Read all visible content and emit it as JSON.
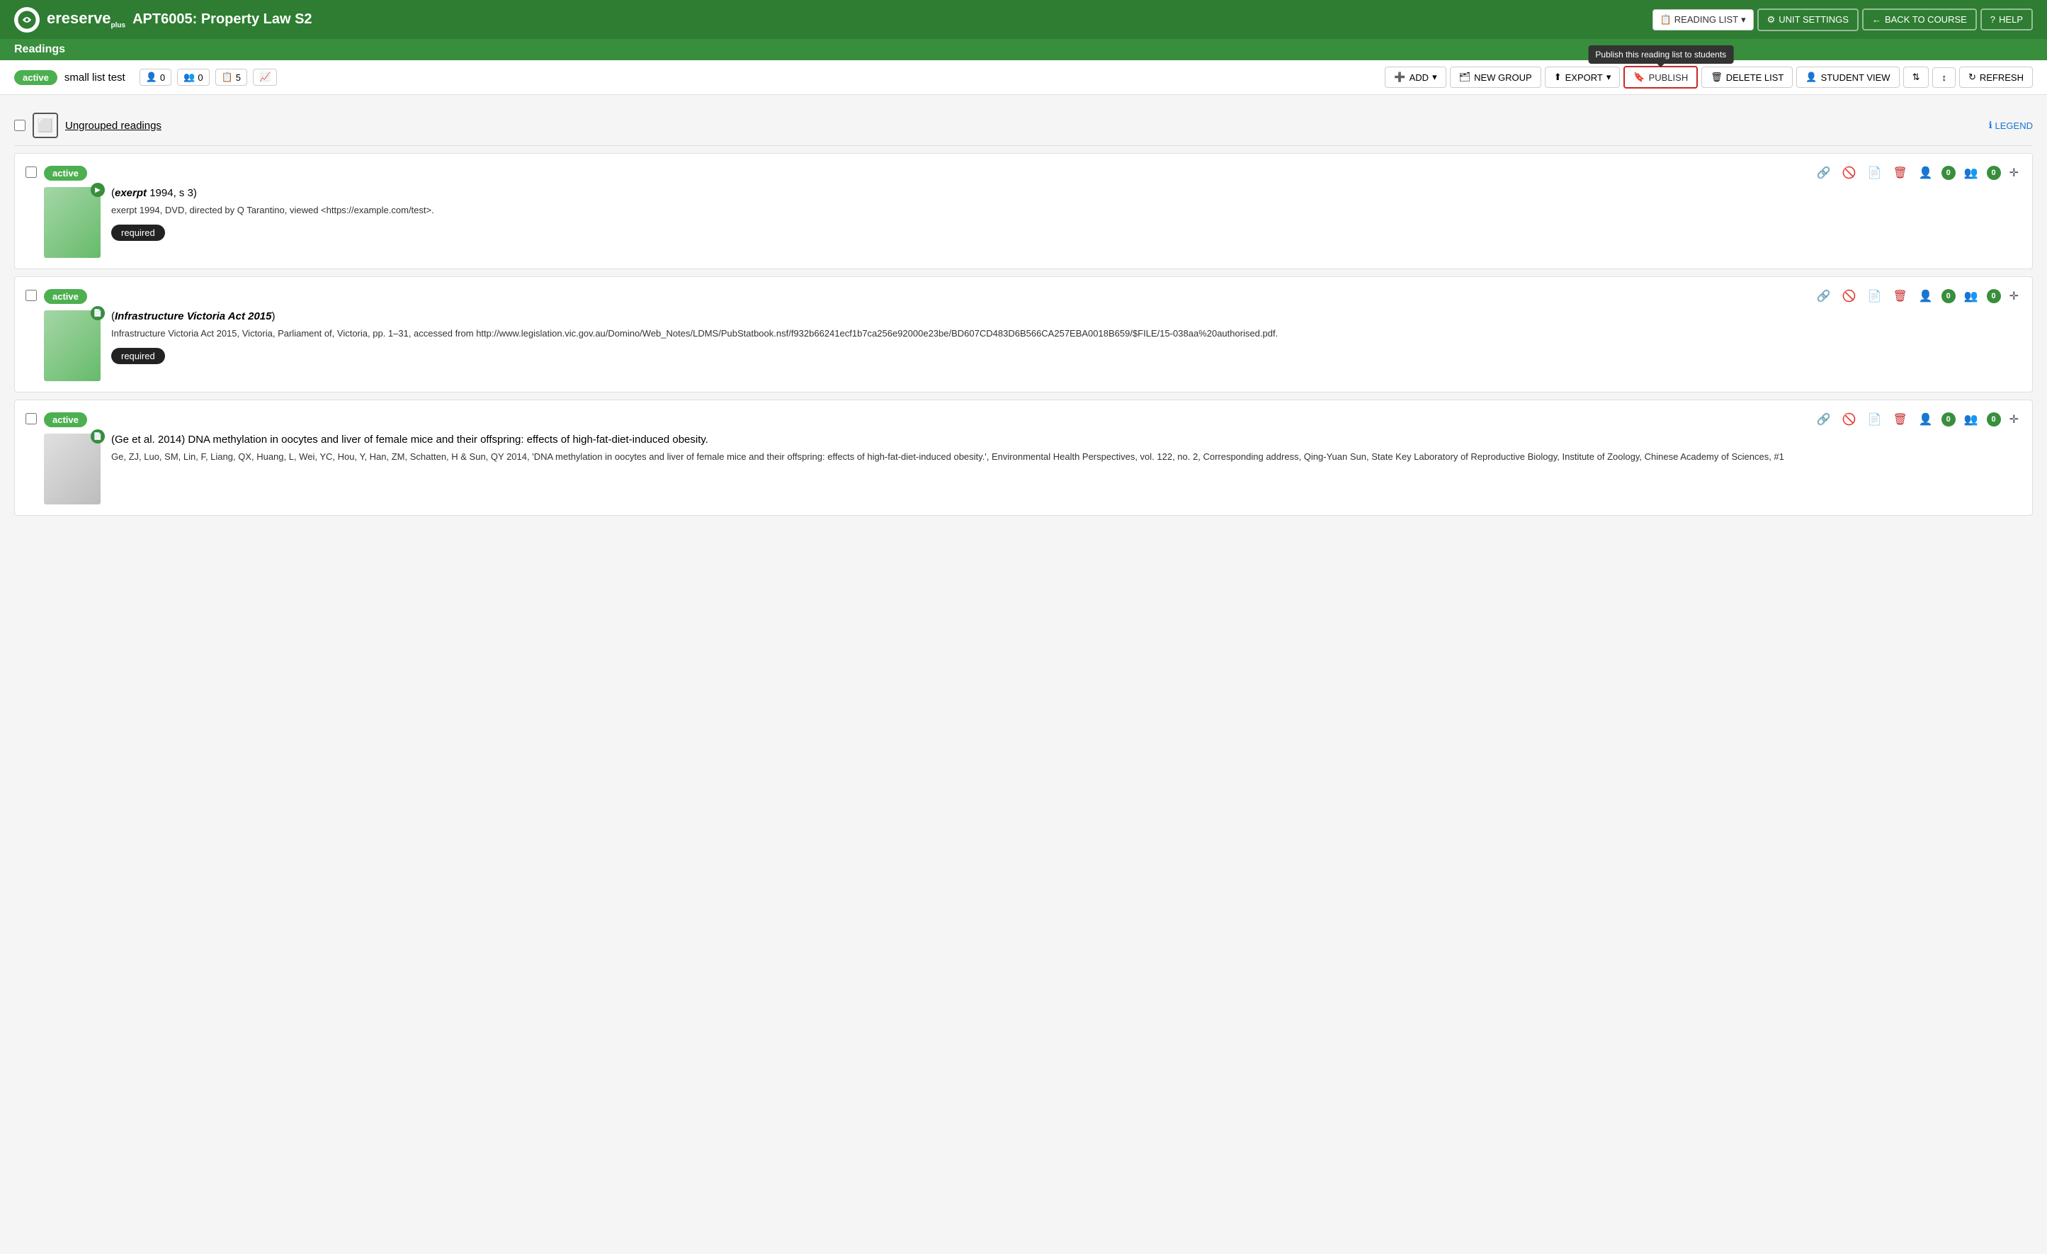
{
  "app": {
    "logo_text": "ereserve",
    "logo_sub": "plus",
    "course_code": "APT6005:",
    "course_name": "Property Law S2"
  },
  "subheader": {
    "readings_label": "Readings"
  },
  "header_buttons": {
    "reading_list": "READING LIST",
    "unit_settings": "UNIT SETTINGS",
    "back_to_course": "BACK TO COURSE",
    "help": "HELP"
  },
  "list_meta": {
    "status": "active",
    "name": "small list test",
    "individual_count": "0",
    "group_count": "0",
    "doc_count": "5"
  },
  "toolbar": {
    "add": "ADD",
    "new_group": "NEW GROUP",
    "export": "EXPORT",
    "publish": "PUBLISH",
    "publish_tooltip": "Publish this reading list to students",
    "delete_list": "DELETE LIST",
    "student_view": "STUDENT VIEW",
    "refresh": "REFRESH"
  },
  "group": {
    "title": "Ungrouped readings",
    "legend": "LEGEND"
  },
  "readings": [
    {
      "id": 1,
      "status": "active",
      "title_prefix": "",
      "title_italic": "exerpt",
      "title_suffix": " 1994, s 3)",
      "title_full": "(exerpt 1994, s 3)",
      "citation": "exerpt 1994, DVD, directed by Q Tarantino, viewed <https://example.com/test>.",
      "required": true,
      "required_label": "required",
      "views_individual": "0",
      "views_group": "0",
      "thumb_icon": "▶"
    },
    {
      "id": 2,
      "status": "active",
      "title_prefix": "(",
      "title_italic": "Infrastructure Victoria Act 2015",
      "title_suffix": ")",
      "title_full": "(Infrastructure Victoria Act 2015)",
      "citation": "Infrastructure Victoria Act 2015, Victoria, Parliament of, Victoria, pp. 1–31, accessed from http://www.legislation.vic.gov.au/Domino/Web_Notes/LDMS/PubStatbook.nsf/f932b66241ecf1b7ca256e92000e23be/BD607CD483D6B566CA257EBA0018B659/$FILE/15-038aa%20authorised.pdf.",
      "required": true,
      "required_label": "required",
      "views_individual": "0",
      "views_group": "0",
      "thumb_icon": "📄"
    },
    {
      "id": 3,
      "status": "active",
      "title_prefix": "(",
      "title_bold": "Ge et al. 2014)",
      "title_suffix": " DNA methylation in oocytes and liver of female mice and their offspring: effects of high-fat-diet-induced obesity.",
      "title_full": "(Ge et al. 2014) DNA methylation in oocytes and liver of female mice and their offspring: effects of high-fat-diet-induced obesity.",
      "citation": "Ge, ZJ, Luo, SM, Lin, F, Liang, QX, Huang, L, Wei, YC, Hou, Y, Han, ZM, Schatten, H & Sun, QY 2014, 'DNA methylation in oocytes and liver of female mice and their offspring: effects of high-fat-diet-induced obesity.', Environmental Health Perspectives, vol. 122, no. 2, Corresponding address, Qing-Yuan Sun, State Key Laboratory of Reproductive Biology, Institute of Zoology, Chinese Academy of Sciences, #1",
      "required": false,
      "required_label": "",
      "views_individual": "0",
      "views_group": "0",
      "thumb_icon": "📄"
    }
  ]
}
